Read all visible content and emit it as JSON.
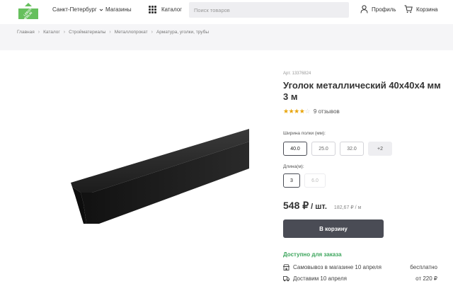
{
  "header": {
    "logo_text": "LEROY MERLIN",
    "city": "Санкт-Петербург",
    "stores": "Магазины",
    "catalog": "Каталог",
    "search_placeholder": "Поиск товаров",
    "profile": "Профиль",
    "cart": "Корзина",
    "brand_color": "#66c05d"
  },
  "breadcrumbs": [
    "Главная",
    "Каталог",
    "Стройматериалы",
    "Металлопрокат",
    "Арматура, уголки, трубы"
  ],
  "product": {
    "article": "Арт. 13376824",
    "title": "Уголок металлический 40x40x4 мм 3 м",
    "rating_value": 3.5,
    "rating_max": 5,
    "reviews": "9 отзывов",
    "width_label": "Ширина полки (мм):",
    "width_options": [
      "40.0",
      "25.0",
      "32.0",
      "+2"
    ],
    "width_selected": "40.0",
    "length_label": "Длина(м):",
    "length_options": [
      "3",
      "6.0"
    ],
    "length_selected": "3",
    "price": "548 ₽",
    "price_unit": "/ шт.",
    "price_per_meter": "182,67 ₽ / м",
    "buy_button": "В корзину",
    "availability": "Доступно для заказа",
    "delivery": [
      {
        "icon": "store-icon",
        "label": "Самовывоз в магазине 10 апреля",
        "value": "бесплатно"
      },
      {
        "icon": "truck-icon",
        "label": "Доставим 10 апреля",
        "value": "от 220 ₽"
      }
    ]
  }
}
